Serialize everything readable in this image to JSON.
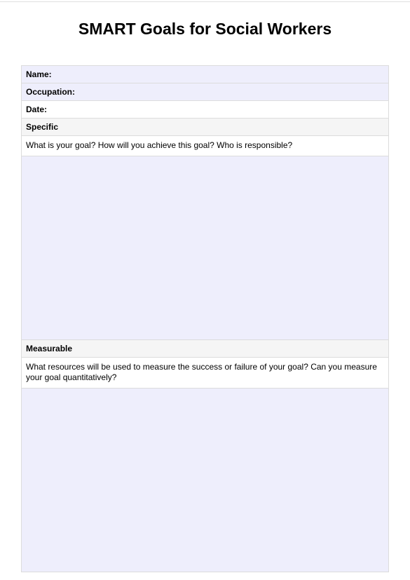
{
  "title": "SMART Goals for Social Workers",
  "fields": {
    "name_label": "Name:",
    "occupation_label": "Occupation:",
    "date_label": "Date:"
  },
  "sections": {
    "specific": {
      "header": "Specific",
      "prompt": "What is your goal? How will you achieve this goal? Who is responsible?"
    },
    "measurable": {
      "header": "Measurable",
      "prompt": "What resources will be used to measure the success or failure of your goal? Can you measure your goal quantitatively?"
    }
  }
}
